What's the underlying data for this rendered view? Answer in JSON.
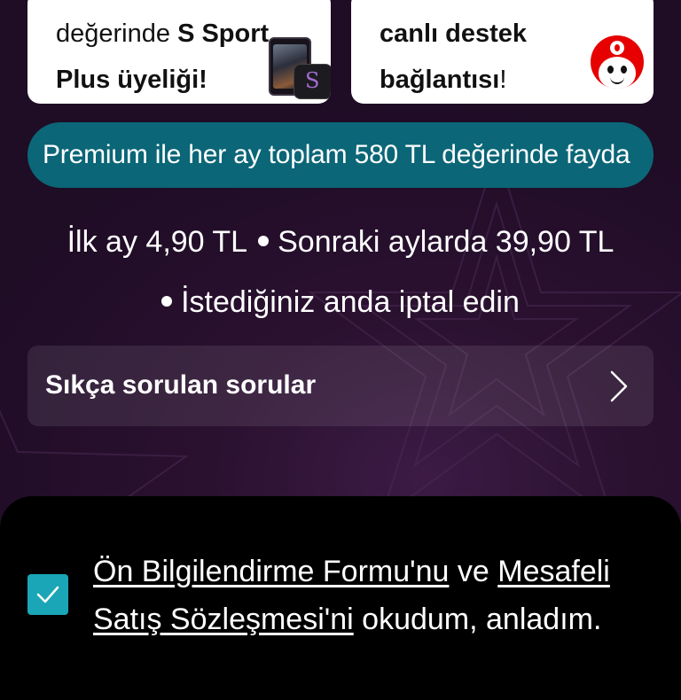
{
  "promo_cards": [
    {
      "line1_prefix": "değerinde ",
      "line1_bold": "S Sport",
      "line2": "Plus üyeliği!",
      "image": "s-sport-devices"
    },
    {
      "line1": "canlı destek",
      "line2_bold": "bağlantısı",
      "line2_suffix": "!",
      "image": "vodafone-mascot"
    }
  ],
  "banner": {
    "text": "Premium ile her ay toplam 580 TL değerinde fayda"
  },
  "pricing": {
    "first_month": "İlk ay 4,90 TL",
    "later_months": "Sonraki aylarda 39,90 TL",
    "cancel": "İstediğiniz anda iptal edin"
  },
  "faq": {
    "label": "Sıkça sorulan sorular",
    "icon": "chevron-right-icon"
  },
  "consent": {
    "checked": true,
    "link1": "Ön Bilgilendirme Formu'nu",
    "connector": " ve ",
    "link2": "Mesafeli Satış Sözleşmesi'ni",
    "suffix": " okudum, anladım."
  },
  "colors": {
    "background": "#26102c",
    "banner": "#0b6677",
    "checkbox": "#1aa6b7",
    "sheet": "#000000",
    "brand_red": "#e60000"
  }
}
